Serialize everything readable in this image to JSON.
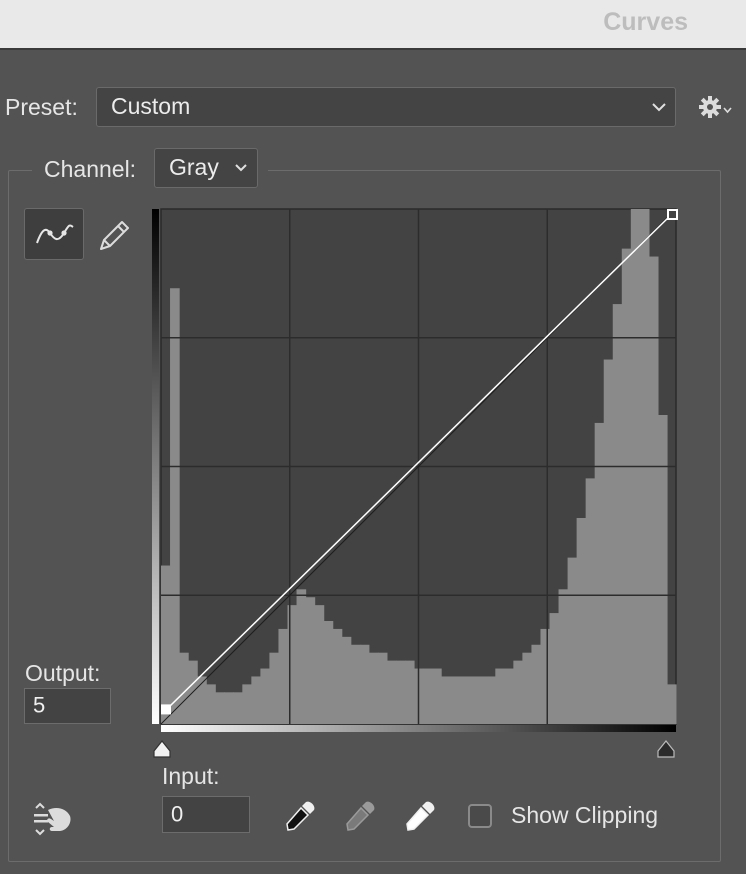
{
  "panel": {
    "title": "Curves"
  },
  "preset": {
    "label": "Preset:",
    "value": "Custom",
    "settings_icon": "gear-icon"
  },
  "channel": {
    "label": "Channel:",
    "value": "Gray"
  },
  "tools": {
    "curve_tool_icon": "curve-point-icon",
    "pencil_tool_icon": "pencil-icon"
  },
  "output": {
    "label": "Output:",
    "value": "5"
  },
  "input": {
    "label": "Input:",
    "value": "0"
  },
  "eyedroppers": [
    "black-point-eyedropper-icon",
    "gray-point-eyedropper-icon",
    "white-point-eyedropper-icon"
  ],
  "show_clipping": {
    "label": "Show Clipping",
    "checked": false
  },
  "on_image_tool_icon": "targeted-adjustment-icon",
  "curve": {
    "points": [
      [
        0,
        5
      ],
      [
        255,
        255
      ]
    ],
    "input_range": [
      0,
      255
    ],
    "output_range": [
      0,
      255
    ]
  },
  "histogram": {
    "bins": [
      20,
      55,
      9,
      8,
      6,
      5,
      4,
      4,
      4,
      5,
      6,
      7,
      9,
      12,
      15,
      17,
      16,
      15,
      13,
      12,
      11,
      10,
      10,
      9,
      9,
      8,
      8,
      8,
      7,
      7,
      7,
      6,
      6,
      6,
      6,
      6,
      6,
      7,
      7,
      8,
      9,
      10,
      12,
      14,
      17,
      21,
      26,
      31,
      38,
      46,
      53,
      60,
      67,
      72,
      59,
      39,
      5
    ],
    "max": 65
  },
  "colors": {
    "panel_bg": "#535353",
    "graph_bg": "#434343",
    "histogram": "#8a8a8a",
    "curve": "#ffffff"
  }
}
